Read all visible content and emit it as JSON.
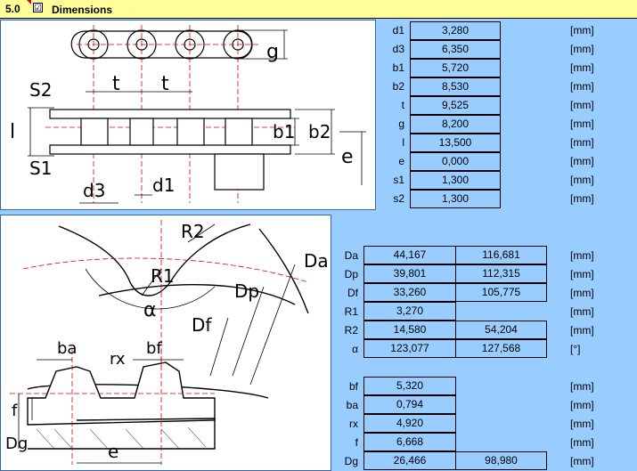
{
  "header": {
    "number": "5.0",
    "title": "Dimensions",
    "checked": true,
    "check_mark": "☑"
  },
  "chain": {
    "rows": [
      {
        "label": "d1",
        "value": "3,280",
        "unit": "[mm]"
      },
      {
        "label": "d3",
        "value": "6,350",
        "unit": "[mm]"
      },
      {
        "label": "b1",
        "value": "5,720",
        "unit": "[mm]"
      },
      {
        "label": "b2",
        "value": "8,530",
        "unit": "[mm]"
      },
      {
        "label": "t",
        "value": "9,525",
        "unit": "[mm]"
      },
      {
        "label": "g",
        "value": "8,200",
        "unit": "[mm]"
      },
      {
        "label": "l",
        "value": "13,500",
        "unit": "[mm]"
      },
      {
        "label": "e",
        "value": "0,000",
        "unit": "[mm]"
      },
      {
        "label": "s1",
        "value": "1,300",
        "unit": "[mm]"
      },
      {
        "label": "s2",
        "value": "1,300",
        "unit": "[mm]"
      }
    ]
  },
  "sprocket": {
    "rows": [
      {
        "label": "Da",
        "v1": "44,167",
        "v2": "116,681",
        "unit": "[mm]"
      },
      {
        "label": "Dp",
        "v1": "39,801",
        "v2": "112,315",
        "unit": "[mm]"
      },
      {
        "label": "Df",
        "v1": "33,260",
        "v2": "105,775",
        "unit": "[mm]"
      },
      {
        "label": "R1",
        "v1": "3,270",
        "v2": "",
        "unit": "[mm]"
      },
      {
        "label": "R2",
        "v1": "14,580",
        "v2": "54,204",
        "unit": "[mm]"
      },
      {
        "label": "α",
        "v1": "123,077",
        "v2": "127,568",
        "unit": "[°]"
      }
    ]
  },
  "tooth": {
    "rows": [
      {
        "label": "bf",
        "v1": "5,320",
        "v2": "",
        "unit": "[mm]"
      },
      {
        "label": "ba",
        "v1": "0,794",
        "v2": "",
        "unit": "[mm]"
      },
      {
        "label": "rx",
        "v1": "4,920",
        "v2": "",
        "unit": "[mm]"
      },
      {
        "label": "f",
        "v1": "6,668",
        "v2": "",
        "unit": "[mm]"
      },
      {
        "label": "Dg",
        "v1": "26,466",
        "v2": "98,980",
        "unit": "[mm]"
      }
    ]
  },
  "diagram_labels": {
    "chain": {
      "s2": "S2",
      "t1": "t",
      "t2": "t",
      "g": "g",
      "l": "l",
      "b1": "b1",
      "b2": "b2",
      "e": "e",
      "s1": "S1",
      "d3": "d3",
      "d1": "d1"
    },
    "sprocket": {
      "R2": "R2",
      "Da": "Da",
      "R1": "R1",
      "Dp": "Dp",
      "alpha": "α",
      "Df": "Df"
    },
    "tooth": {
      "ba": "ba",
      "bf": "bf",
      "rx": "rx",
      "f": "f",
      "Dg": "Dg",
      "e": "e"
    }
  }
}
